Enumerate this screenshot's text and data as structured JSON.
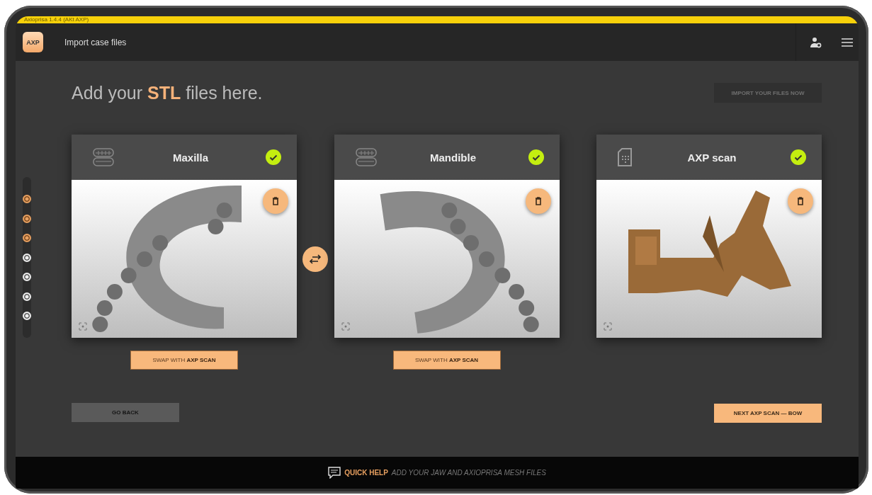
{
  "window": {
    "title": "Axioprisa 1.4.4 (AKt AXP)"
  },
  "header": {
    "logo": "AXP",
    "title": "Import case files"
  },
  "steps": [
    {
      "completed": true
    },
    {
      "completed": true
    },
    {
      "completed": true
    },
    {
      "completed": false
    },
    {
      "completed": false
    },
    {
      "completed": false
    },
    {
      "completed": false
    }
  ],
  "heading": "Add your **STL** files here.",
  "import_button": {
    "label": "IMPORT YOUR FILES NOW",
    "disabled": true
  },
  "cards": [
    {
      "title": "Maxilla",
      "kind": "jaw",
      "verified": true,
      "swap_button": "SWAP WITH **AXP SCAN**"
    },
    {
      "title": "Mandible",
      "kind": "jaw",
      "verified": true,
      "swap_button": "SWAP WITH **AXP SCAN**"
    },
    {
      "title": "AXP scan",
      "kind": "scan",
      "verified": true
    }
  ],
  "go_back": "GO BACK",
  "next_button": "NEXT AXP SCAN — BOW",
  "quick_help": {
    "label": "QUICK HELP",
    "text": "ADD YOUR JAW AND AXIOPRISA MESH FILES"
  }
}
